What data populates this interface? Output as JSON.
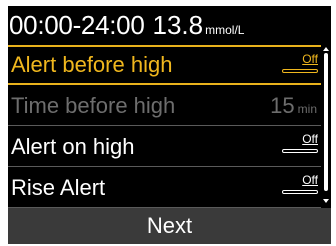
{
  "header": {
    "time_range": "00:00-24:00",
    "glucose_value": "13.8",
    "glucose_unit": "mmol/L"
  },
  "settings": {
    "alert_before_high": {
      "label": "Alert before high",
      "toggle": "Off",
      "selected": true
    },
    "time_before_high": {
      "label": "Time before high",
      "value": "15",
      "unit": "min",
      "disabled": true
    },
    "alert_on_high": {
      "label": "Alert on high",
      "toggle": "Off"
    },
    "rise_alert": {
      "label": "Rise Alert",
      "toggle": "Off"
    }
  },
  "footer": {
    "next_label": "Next"
  },
  "colors": {
    "background": "#000000",
    "selection": "#e8b21c",
    "disabled_text": "#6d6d6d",
    "footer": "#3a3a3a"
  }
}
